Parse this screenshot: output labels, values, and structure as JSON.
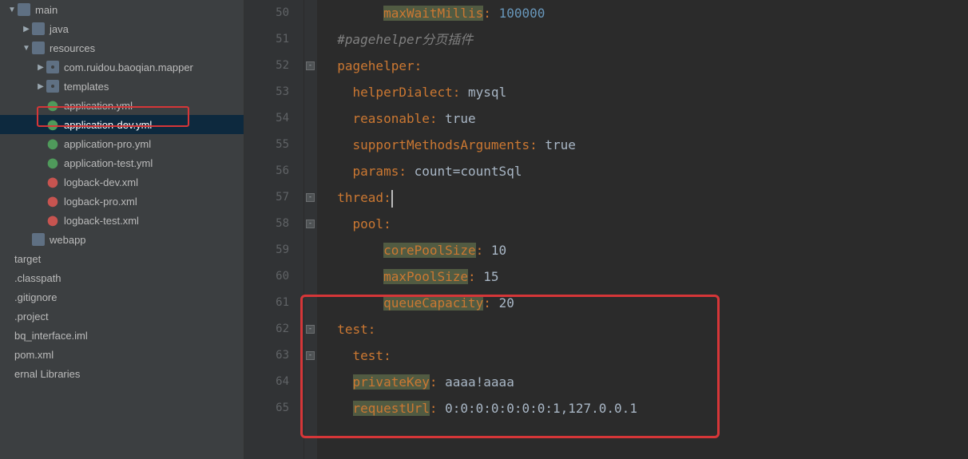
{
  "sidebar": {
    "items": [
      {
        "depth": 0,
        "arrow": "open",
        "icon": "folder",
        "label": "main"
      },
      {
        "depth": 1,
        "arrow": "closed",
        "icon": "folder",
        "label": "java"
      },
      {
        "depth": 1,
        "arrow": "open",
        "icon": "folder",
        "label": "resources"
      },
      {
        "depth": 2,
        "arrow": "closed",
        "icon": "pkg",
        "label": "com.ruidou.baoqian.mapper"
      },
      {
        "depth": 2,
        "arrow": "closed",
        "icon": "pkg",
        "label": "templates"
      },
      {
        "depth": 2,
        "arrow": "none",
        "icon": "yml",
        "label": "application.yml"
      },
      {
        "depth": 2,
        "arrow": "none",
        "icon": "yml",
        "label": "application-dev.yml",
        "selected": true
      },
      {
        "depth": 2,
        "arrow": "none",
        "icon": "yml",
        "label": "application-pro.yml"
      },
      {
        "depth": 2,
        "arrow": "none",
        "icon": "yml",
        "label": "application-test.yml"
      },
      {
        "depth": 2,
        "arrow": "none",
        "icon": "xml",
        "label": "logback-dev.xml"
      },
      {
        "depth": 2,
        "arrow": "none",
        "icon": "xml",
        "label": "logback-pro.xml"
      },
      {
        "depth": 2,
        "arrow": "none",
        "icon": "xml",
        "label": "logback-test.xml"
      },
      {
        "depth": 1,
        "arrow": "none",
        "icon": "folder",
        "label": "webapp"
      },
      {
        "depth": -1,
        "arrow": "none",
        "icon": "",
        "label": "target"
      },
      {
        "depth": -1,
        "arrow": "none",
        "icon": "",
        "label": ".classpath"
      },
      {
        "depth": -1,
        "arrow": "none",
        "icon": "",
        "label": ".gitignore"
      },
      {
        "depth": -1,
        "arrow": "none",
        "icon": "",
        "label": ".project"
      },
      {
        "depth": -1,
        "arrow": "none",
        "icon": "",
        "label": "bq_interface.iml"
      },
      {
        "depth": -1,
        "arrow": "none",
        "icon": "",
        "label": "pom.xml"
      },
      {
        "depth": -1,
        "arrow": "none",
        "icon": "",
        "label": "ernal Libraries"
      }
    ]
  },
  "editor": {
    "line_numbers": [
      "",
      "50",
      "51",
      "52",
      "53",
      "54",
      "55",
      "56",
      "57",
      "58",
      "59",
      "60",
      "61",
      "62",
      "63",
      "64",
      "65"
    ],
    "lines": {
      "49": {
        "indent": 3,
        "seg": [
          {
            "cls": "tok-key-hl",
            "t": "maxWaitMillis"
          },
          {
            "cls": "tok-colon",
            "t": ": "
          },
          {
            "cls": "tok-num",
            "t": "100000"
          }
        ]
      },
      "50": {
        "indent": 1,
        "seg": [
          {
            "cls": "tok-comment",
            "t": "#pagehelper分页插件"
          }
        ]
      },
      "51": {
        "indent": 1,
        "seg": [
          {
            "cls": "tok-key",
            "t": "pagehelper"
          },
          {
            "cls": "tok-colon",
            "t": ":"
          }
        ]
      },
      "52": {
        "indent": 2,
        "seg": [
          {
            "cls": "tok-key",
            "t": "helperDialect"
          },
          {
            "cls": "tok-colon",
            "t": ": "
          },
          {
            "cls": "tok-val",
            "t": "mysql"
          }
        ]
      },
      "53": {
        "indent": 2,
        "seg": [
          {
            "cls": "tok-key",
            "t": "reasonable"
          },
          {
            "cls": "tok-colon",
            "t": ": "
          },
          {
            "cls": "tok-val",
            "t": "true"
          }
        ]
      },
      "54": {
        "indent": 2,
        "seg": [
          {
            "cls": "tok-key",
            "t": "supportMethodsArguments"
          },
          {
            "cls": "tok-colon",
            "t": ": "
          },
          {
            "cls": "tok-val",
            "t": "true"
          }
        ]
      },
      "55": {
        "indent": 2,
        "seg": [
          {
            "cls": "tok-key",
            "t": "params"
          },
          {
            "cls": "tok-colon",
            "t": ": "
          },
          {
            "cls": "tok-val",
            "t": "count=countSql"
          }
        ]
      },
      "56": {
        "indent": 1,
        "seg": [
          {
            "cls": "tok-key",
            "t": "thread"
          },
          {
            "cls": "tok-colon",
            "t": ":"
          }
        ],
        "caret": true
      },
      "57": {
        "indent": 2,
        "seg": [
          {
            "cls": "tok-key",
            "t": "pool"
          },
          {
            "cls": "tok-colon",
            "t": ":"
          }
        ]
      },
      "58": {
        "indent": 3,
        "seg": [
          {
            "cls": "tok-key-hl",
            "t": "corePoolSize"
          },
          {
            "cls": "tok-colon",
            "t": ": "
          },
          {
            "cls": "tok-val",
            "t": "10"
          }
        ]
      },
      "59": {
        "indent": 3,
        "seg": [
          {
            "cls": "tok-key-hl",
            "t": "maxPoolSize"
          },
          {
            "cls": "tok-colon",
            "t": ": "
          },
          {
            "cls": "tok-val",
            "t": "15"
          }
        ]
      },
      "60": {
        "indent": 3,
        "seg": [
          {
            "cls": "tok-key-hl",
            "t": "queueCapacity"
          },
          {
            "cls": "tok-colon",
            "t": ": "
          },
          {
            "cls": "tok-val",
            "t": "20"
          }
        ]
      },
      "61": {
        "indent": 1,
        "seg": [
          {
            "cls": "tok-key",
            "t": "test"
          },
          {
            "cls": "tok-colon",
            "t": ":"
          }
        ]
      },
      "62": {
        "indent": 2,
        "seg": [
          {
            "cls": "tok-key",
            "t": "test"
          },
          {
            "cls": "tok-colon",
            "t": ":"
          }
        ]
      },
      "63": {
        "indent": 2,
        "seg": [
          {
            "cls": "tok-key-hl",
            "t": "privateKey"
          },
          {
            "cls": "tok-colon",
            "t": ": "
          },
          {
            "cls": "tok-val",
            "t": "aaaa!aaaa"
          }
        ]
      },
      "64": {
        "indent": 2,
        "seg": [
          {
            "cls": "tok-key-hl",
            "t": "requestUrl"
          },
          {
            "cls": "tok-colon",
            "t": ": "
          },
          {
            "cls": "tok-val",
            "t": "0:0:0:0:0:0:0:1,127.0.0.1"
          }
        ]
      },
      "65": {
        "indent": 0,
        "seg": []
      }
    },
    "fold_marks": [
      51,
      56,
      57,
      61,
      62
    ]
  }
}
